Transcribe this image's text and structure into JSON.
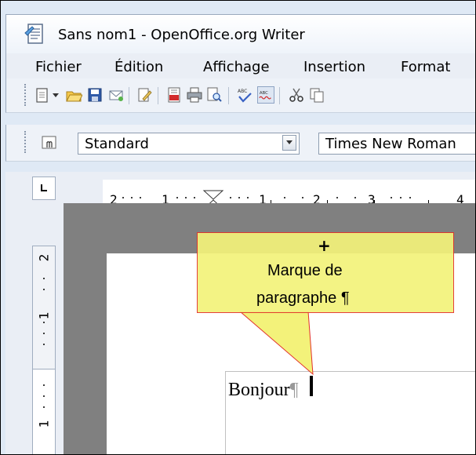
{
  "window": {
    "title": "Sans nom1 - OpenOffice.org Writer"
  },
  "menu": {
    "items": [
      "Fichier",
      "Édition",
      "Affichage",
      "Insertion",
      "Format"
    ]
  },
  "toolbar": {
    "icons": [
      "new-document-icon",
      "open-icon",
      "save-icon",
      "email-icon",
      "edit-file-icon",
      "export-pdf-icon",
      "print-icon",
      "page-preview-icon",
      "spellcheck-icon",
      "autospellcheck-icon",
      "cut-icon",
      "copy-icon"
    ]
  },
  "formatting": {
    "paragraph_style": "Standard",
    "font_name": "Times New Roman"
  },
  "ruler": {
    "labels": [
      "2",
      "1",
      "1",
      "2",
      "3",
      "4"
    ],
    "vertical_labels": [
      "2",
      "1",
      "1"
    ]
  },
  "document": {
    "text": "Bonjour",
    "pilcrow": "¶"
  },
  "callout": {
    "plus": "+",
    "line1": "Marque  de",
    "line2": "paragraphe ¶",
    "fill": "#f3f27a",
    "border": "#e2302a"
  }
}
